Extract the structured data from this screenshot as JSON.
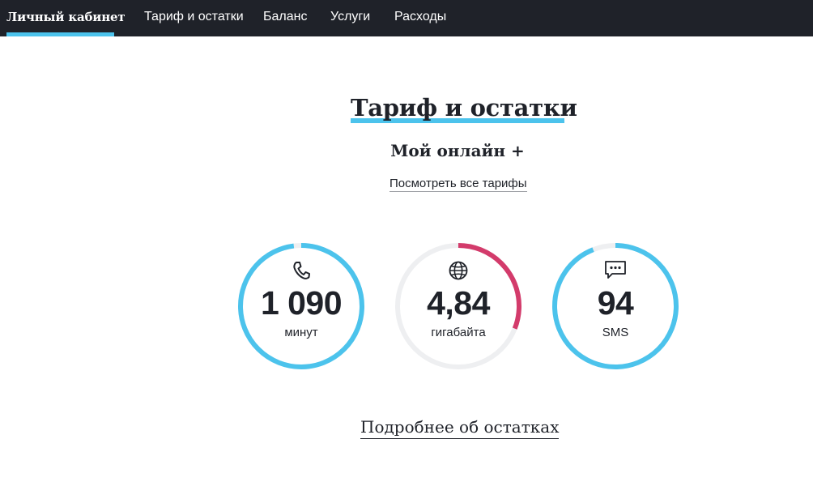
{
  "nav": {
    "items": [
      {
        "label": "Личный кабинет",
        "active": true
      },
      {
        "label": "Тариф и остатки",
        "active": false
      },
      {
        "label": "Баланс",
        "active": false
      },
      {
        "label": "Услуги",
        "active": false
      },
      {
        "label": "Расходы",
        "active": false
      }
    ]
  },
  "page": {
    "title": "Тариф и остатки",
    "plan_name": "Мой онлайн +",
    "all_tariffs_link": "Посмотреть все тарифы",
    "details_link": "Подробнее об остатках"
  },
  "remaining": [
    {
      "icon": "phone-icon",
      "value": "1 090",
      "unit": "минут",
      "fill_fraction": 0.98,
      "color": "#4cc3ec"
    },
    {
      "icon": "globe-icon",
      "value": "4,84",
      "unit": "гигабайта",
      "fill_fraction": 0.31,
      "color": "#d33b6b"
    },
    {
      "icon": "chat-icon",
      "value": "94",
      "unit": "SMS",
      "fill_fraction": 0.94,
      "color": "#4cc3ec"
    }
  ],
  "colors": {
    "nav_background": "#1f2229",
    "accent": "#4cc3ec",
    "data_accent": "#d33b6b",
    "track": "#eeeff1",
    "text": "#1f2229"
  }
}
